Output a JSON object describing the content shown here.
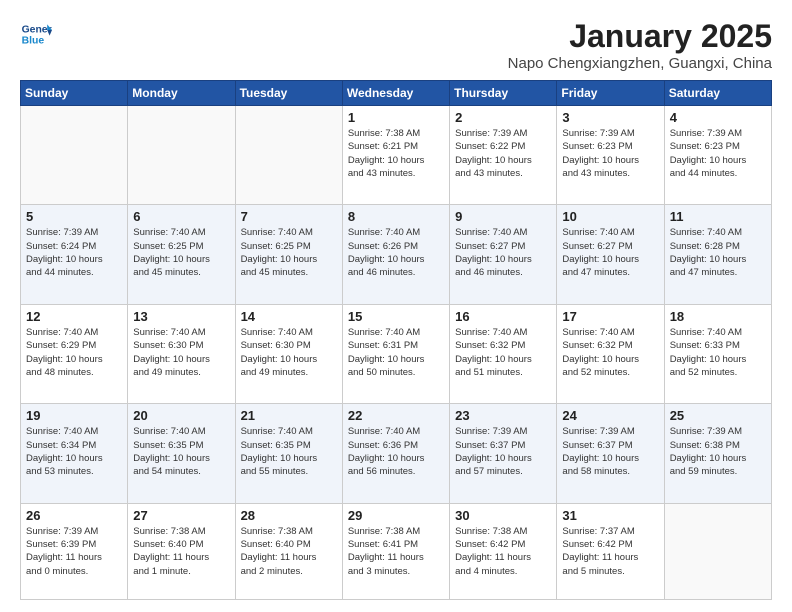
{
  "header": {
    "logo_line1": "General",
    "logo_line2": "Blue",
    "title": "January 2025",
    "subtitle": "Napo Chengxiangzhen, Guangxi, China"
  },
  "weekdays": [
    "Sunday",
    "Monday",
    "Tuesday",
    "Wednesday",
    "Thursday",
    "Friday",
    "Saturday"
  ],
  "weeks": [
    [
      {
        "day": "",
        "info": ""
      },
      {
        "day": "",
        "info": ""
      },
      {
        "day": "",
        "info": ""
      },
      {
        "day": "1",
        "info": "Sunrise: 7:38 AM\nSunset: 6:21 PM\nDaylight: 10 hours\nand 43 minutes."
      },
      {
        "day": "2",
        "info": "Sunrise: 7:39 AM\nSunset: 6:22 PM\nDaylight: 10 hours\nand 43 minutes."
      },
      {
        "day": "3",
        "info": "Sunrise: 7:39 AM\nSunset: 6:23 PM\nDaylight: 10 hours\nand 43 minutes."
      },
      {
        "day": "4",
        "info": "Sunrise: 7:39 AM\nSunset: 6:23 PM\nDaylight: 10 hours\nand 44 minutes."
      }
    ],
    [
      {
        "day": "5",
        "info": "Sunrise: 7:39 AM\nSunset: 6:24 PM\nDaylight: 10 hours\nand 44 minutes."
      },
      {
        "day": "6",
        "info": "Sunrise: 7:40 AM\nSunset: 6:25 PM\nDaylight: 10 hours\nand 45 minutes."
      },
      {
        "day": "7",
        "info": "Sunrise: 7:40 AM\nSunset: 6:25 PM\nDaylight: 10 hours\nand 45 minutes."
      },
      {
        "day": "8",
        "info": "Sunrise: 7:40 AM\nSunset: 6:26 PM\nDaylight: 10 hours\nand 46 minutes."
      },
      {
        "day": "9",
        "info": "Sunrise: 7:40 AM\nSunset: 6:27 PM\nDaylight: 10 hours\nand 46 minutes."
      },
      {
        "day": "10",
        "info": "Sunrise: 7:40 AM\nSunset: 6:27 PM\nDaylight: 10 hours\nand 47 minutes."
      },
      {
        "day": "11",
        "info": "Sunrise: 7:40 AM\nSunset: 6:28 PM\nDaylight: 10 hours\nand 47 minutes."
      }
    ],
    [
      {
        "day": "12",
        "info": "Sunrise: 7:40 AM\nSunset: 6:29 PM\nDaylight: 10 hours\nand 48 minutes."
      },
      {
        "day": "13",
        "info": "Sunrise: 7:40 AM\nSunset: 6:30 PM\nDaylight: 10 hours\nand 49 minutes."
      },
      {
        "day": "14",
        "info": "Sunrise: 7:40 AM\nSunset: 6:30 PM\nDaylight: 10 hours\nand 49 minutes."
      },
      {
        "day": "15",
        "info": "Sunrise: 7:40 AM\nSunset: 6:31 PM\nDaylight: 10 hours\nand 50 minutes."
      },
      {
        "day": "16",
        "info": "Sunrise: 7:40 AM\nSunset: 6:32 PM\nDaylight: 10 hours\nand 51 minutes."
      },
      {
        "day": "17",
        "info": "Sunrise: 7:40 AM\nSunset: 6:32 PM\nDaylight: 10 hours\nand 52 minutes."
      },
      {
        "day": "18",
        "info": "Sunrise: 7:40 AM\nSunset: 6:33 PM\nDaylight: 10 hours\nand 52 minutes."
      }
    ],
    [
      {
        "day": "19",
        "info": "Sunrise: 7:40 AM\nSunset: 6:34 PM\nDaylight: 10 hours\nand 53 minutes."
      },
      {
        "day": "20",
        "info": "Sunrise: 7:40 AM\nSunset: 6:35 PM\nDaylight: 10 hours\nand 54 minutes."
      },
      {
        "day": "21",
        "info": "Sunrise: 7:40 AM\nSunset: 6:35 PM\nDaylight: 10 hours\nand 55 minutes."
      },
      {
        "day": "22",
        "info": "Sunrise: 7:40 AM\nSunset: 6:36 PM\nDaylight: 10 hours\nand 56 minutes."
      },
      {
        "day": "23",
        "info": "Sunrise: 7:39 AM\nSunset: 6:37 PM\nDaylight: 10 hours\nand 57 minutes."
      },
      {
        "day": "24",
        "info": "Sunrise: 7:39 AM\nSunset: 6:37 PM\nDaylight: 10 hours\nand 58 minutes."
      },
      {
        "day": "25",
        "info": "Sunrise: 7:39 AM\nSunset: 6:38 PM\nDaylight: 10 hours\nand 59 minutes."
      }
    ],
    [
      {
        "day": "26",
        "info": "Sunrise: 7:39 AM\nSunset: 6:39 PM\nDaylight: 11 hours\nand 0 minutes."
      },
      {
        "day": "27",
        "info": "Sunrise: 7:38 AM\nSunset: 6:40 PM\nDaylight: 11 hours\nand 1 minute."
      },
      {
        "day": "28",
        "info": "Sunrise: 7:38 AM\nSunset: 6:40 PM\nDaylight: 11 hours\nand 2 minutes."
      },
      {
        "day": "29",
        "info": "Sunrise: 7:38 AM\nSunset: 6:41 PM\nDaylight: 11 hours\nand 3 minutes."
      },
      {
        "day": "30",
        "info": "Sunrise: 7:38 AM\nSunset: 6:42 PM\nDaylight: 11 hours\nand 4 minutes."
      },
      {
        "day": "31",
        "info": "Sunrise: 7:37 AM\nSunset: 6:42 PM\nDaylight: 11 hours\nand 5 minutes."
      },
      {
        "day": "",
        "info": ""
      }
    ]
  ]
}
